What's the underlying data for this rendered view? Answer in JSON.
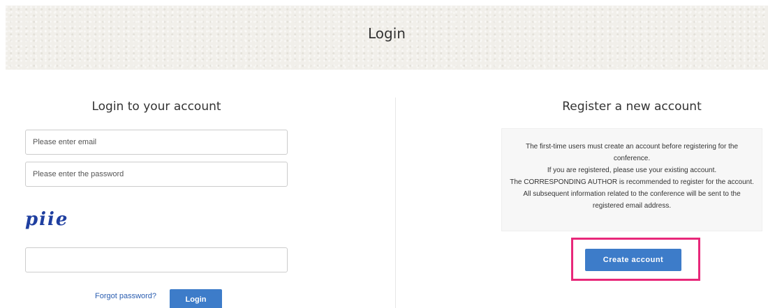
{
  "header": {
    "title": "Login"
  },
  "login": {
    "title": "Login to your account",
    "email_placeholder": "Please enter email",
    "password_placeholder": "Please enter the password",
    "captcha_text": "piie",
    "captcha_value": "",
    "forgot_label": "Forgot password?",
    "login_label": "Login"
  },
  "register": {
    "title": "Register a new account",
    "info_lines": [
      "The first-time users must create an account before registering for the conference.",
      "If you are registered, please use your existing account.",
      "The CORRESPONDING AUTHOR is recommended to register for the account. All subsequent information related to the conference will be sent to the registered email address."
    ],
    "create_label": "Create account"
  },
  "colors": {
    "accent": "#3d7cc9",
    "highlight": "#e8287a",
    "banner": "#f1efea"
  }
}
